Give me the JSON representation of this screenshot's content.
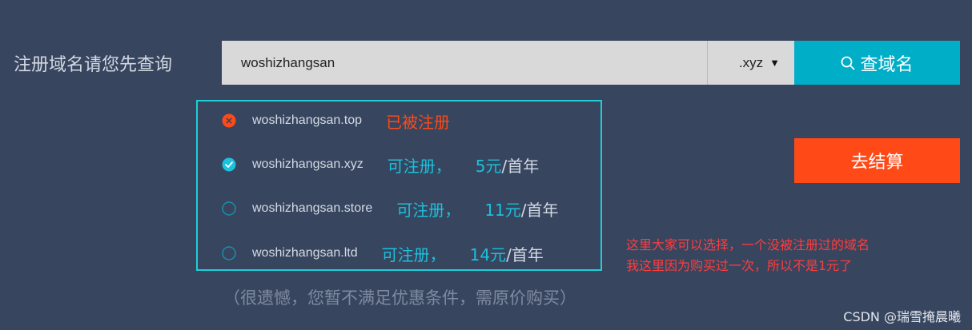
{
  "form": {
    "label": "注册域名请您先查询",
    "search_value": "woshizhangsan",
    "tld": ".xyz",
    "search_button": "查域名",
    "checkout_button": "去结算"
  },
  "results": [
    {
      "domain": "woshizhangsan.top",
      "status": "已被注册",
      "state": "taken"
    },
    {
      "domain": "woshizhangsan.xyz",
      "status": "可注册，",
      "price": "5元",
      "unit": "/首年",
      "state": "selected"
    },
    {
      "domain": "woshizhangsan.store",
      "status": "可注册，",
      "price": "11元",
      "unit": "/首年",
      "state": "available"
    },
    {
      "domain": "woshizhangsan.ltd",
      "status": "可注册，",
      "price": "14元",
      "unit": "/首年",
      "state": "available"
    }
  ],
  "notes": {
    "line1": "这里大家可以选择，一个没被注册过的域名",
    "line2": "我这里因为购买过一次，所以不是1元了"
  },
  "sorry_text": "（很遗憾，您暂不满足优惠条件，需原价购买）",
  "watermark": "CSDN @瑞雪掩晨曦 ",
  "colors": {
    "background": "#37455f",
    "accent_cyan": "#00aec8",
    "accent_orange": "#ff4a17",
    "note_red": "#ff3d3d"
  }
}
